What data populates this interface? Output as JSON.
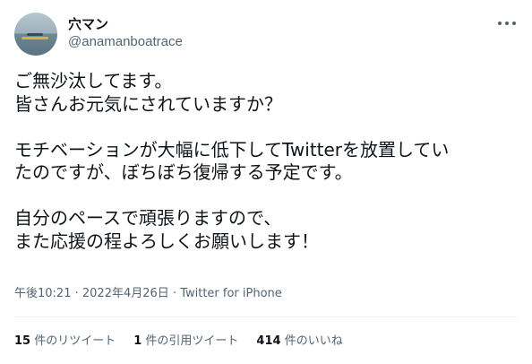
{
  "user": {
    "display_name": "穴マン",
    "handle": "@anamanboatrace"
  },
  "tweet": {
    "lines": [
      "ご無沙汰してます。",
      "皆さんお元気にされていますか？",
      "",
      "モチベーションが大幅に低下してTwitterを放置してい",
      "たのですが、ぼちぼち復帰する予定です。",
      "",
      "自分のペースで頑張りますので、",
      "また応援の程よろしくお願いします！"
    ],
    "time": "午後10:21",
    "date": "2022年4月26日",
    "separator": " · ",
    "source": "Twitter for iPhone"
  },
  "stats": {
    "retweets_count": "15",
    "retweets_label": " 件のリツイート",
    "quotes_count": "1",
    "quotes_label": " 件の引用ツイート",
    "likes_count": "414",
    "likes_label": " 件のいいね"
  },
  "icons": {
    "more": "more-horizontal-icon",
    "avatar": "profile-avatar"
  },
  "colors": {
    "text": "#0f1419",
    "secondary": "#536471",
    "divider": "#eff3f4"
  }
}
